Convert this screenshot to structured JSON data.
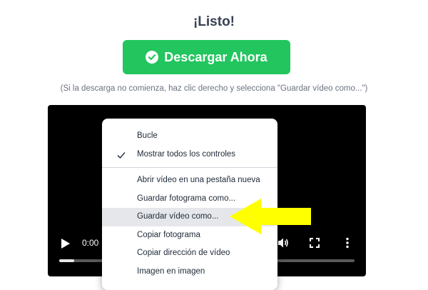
{
  "page": {
    "title": "¡Listo!",
    "download_button": "Descargar Ahora",
    "hint": "(Si la descarga no comienza, haz clic derecho y selecciona \"Guardar vídeo como...\")"
  },
  "video": {
    "time": "0:00",
    "progress": 0.05
  },
  "context_menu": {
    "items": [
      {
        "label": "Bucle",
        "checked": false
      },
      {
        "label": "Mostrar todos los controles",
        "checked": true
      },
      {
        "label": "Abrir vídeo en una pestaña nueva"
      },
      {
        "label": "Guardar fotograma como..."
      },
      {
        "label": "Guardar vídeo como...",
        "highlighted": true
      },
      {
        "label": "Copiar fotograma"
      },
      {
        "label": "Copiar dirección de vídeo"
      },
      {
        "label": "Imagen en imagen"
      }
    ]
  },
  "icons": {
    "download": "check-circle-icon",
    "play": "play-icon",
    "volume": "volume-icon",
    "fullscreen": "fullscreen-icon",
    "more": "more-vertical-icon",
    "check": "checkmark-icon",
    "annotation": "arrow-pointer-icon"
  },
  "colors": {
    "button": "#22c55e",
    "arrow": "#ffff00",
    "highlight": "#e5e7eb"
  }
}
